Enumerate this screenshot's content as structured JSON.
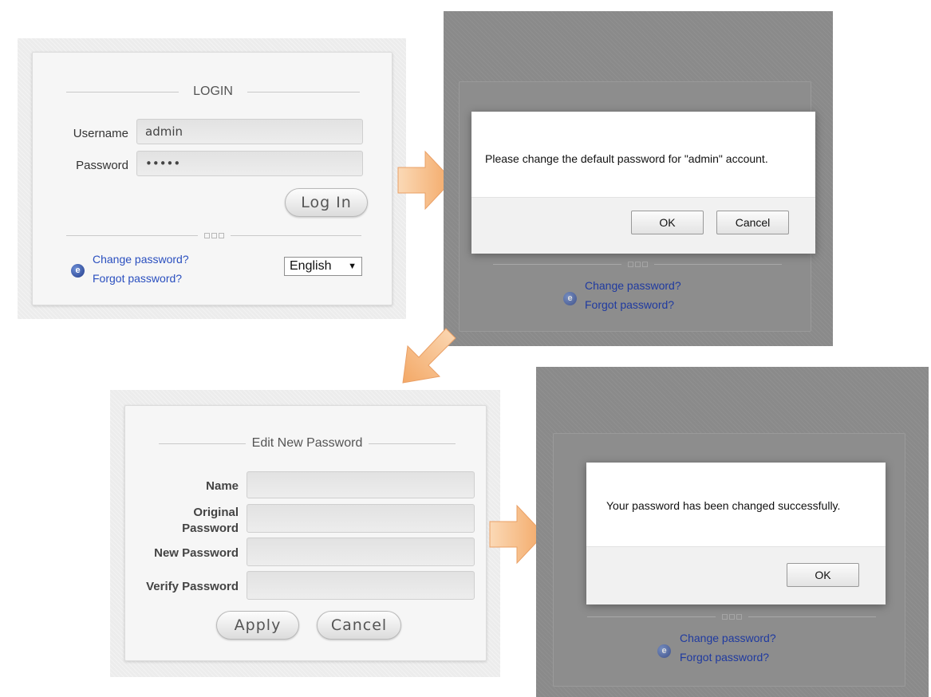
{
  "login": {
    "title": "LOGIN",
    "username_label": "Username",
    "username_value": "admin",
    "password_label": "Password",
    "password_value": "•••••",
    "login_button": "Log In",
    "change_password_link": "Change password?",
    "forgot_password_link": "Forgot password?",
    "language_selected": "English",
    "language_caret": "▼"
  },
  "change_prompt": {
    "message": "Please change the default password for \"admin\" account.",
    "ok_button": "OK",
    "cancel_button": "Cancel",
    "change_password_link": "Change password?",
    "forgot_password_link": "Forgot password?"
  },
  "edit_password": {
    "title": "Edit New Password",
    "name_label": "Name",
    "original_label_1": "Original",
    "original_label_2": "Password",
    "new_label": "New Password",
    "verify_label": "Verify Password",
    "apply_button": "Apply",
    "cancel_button": "Cancel"
  },
  "success": {
    "message": "Your password has been changed successfully.",
    "ok_button": "OK",
    "change_password_link": "Change password?",
    "forgot_password_link": "Forgot password?"
  },
  "colors": {
    "arrow_fill": "#f8c08a",
    "link": "#2a4fbf",
    "overlay": "#8a8a8a"
  },
  "icons": {
    "arrow": "arrow-icon",
    "globe": "globe-icon"
  }
}
